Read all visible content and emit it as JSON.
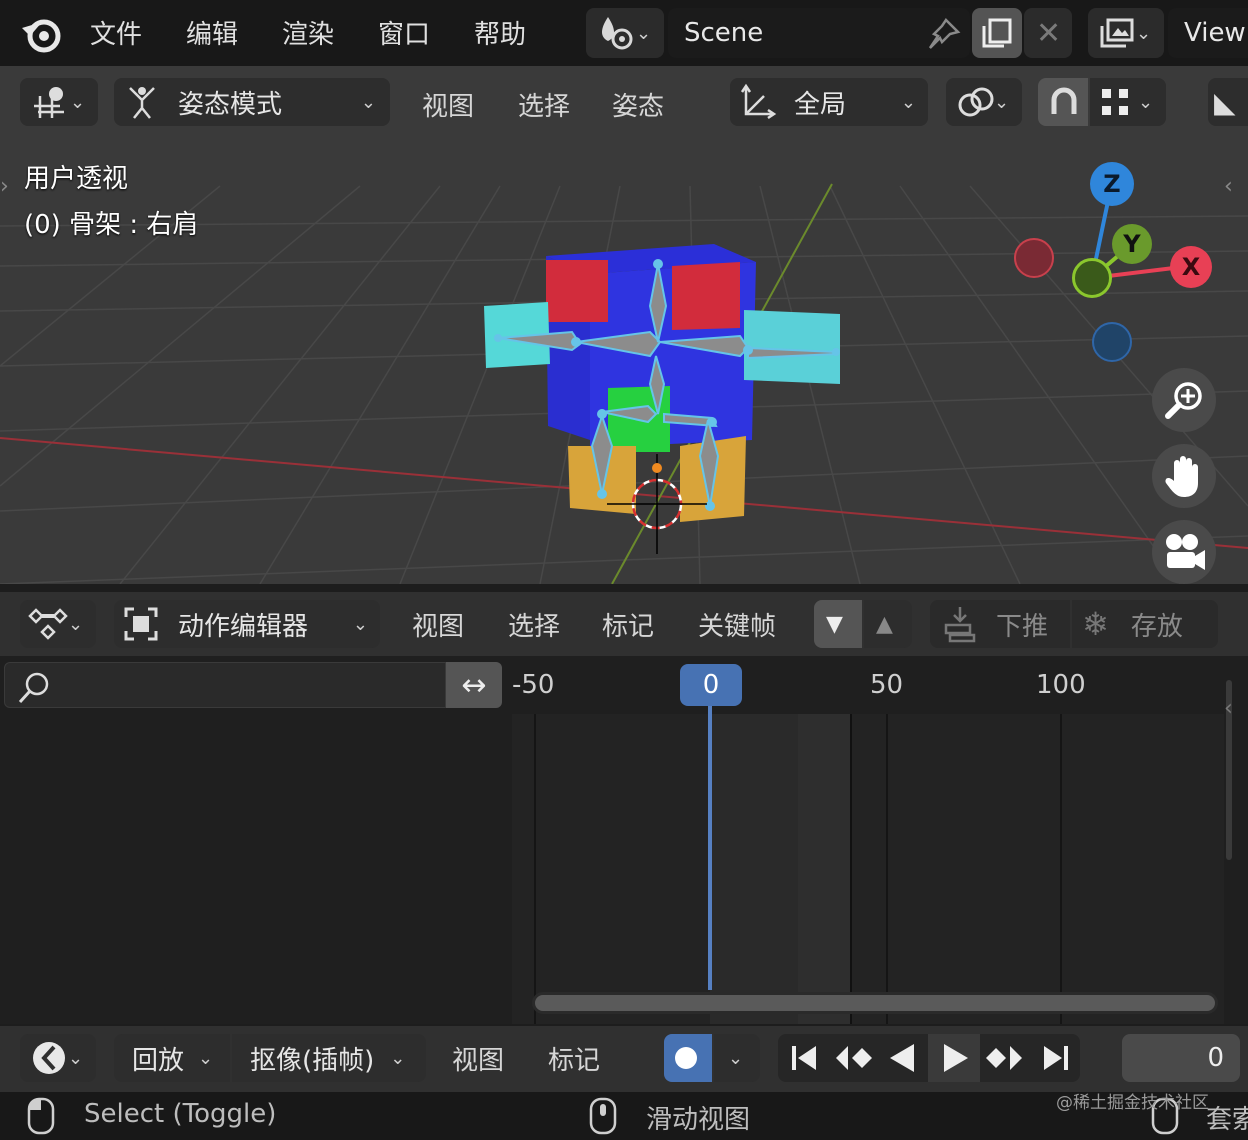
{
  "topbar": {
    "menus": [
      "文件",
      "编辑",
      "渲染",
      "窗口",
      "帮助"
    ],
    "scene_name": "Scene",
    "view_layer": "View"
  },
  "viewport_header": {
    "mode": "姿态模式",
    "menus": [
      "视图",
      "选择",
      "姿态"
    ],
    "transform_orientation": "全局"
  },
  "viewport": {
    "view_name": "用户透视",
    "object_info": "(0) 骨架 : 右肩",
    "gizmo": {
      "z": "Z",
      "y": "Y",
      "x": "X"
    }
  },
  "action_editor": {
    "mode": "动作编辑器",
    "menus": [
      "视图",
      "选择",
      "标记",
      "关键帧"
    ],
    "push_down": "下推",
    "stash": "存放",
    "search_placeholder": "",
    "frame_ticks": [
      "-50",
      "0",
      "50",
      "100"
    ],
    "current_frame_label": "0"
  },
  "timeline": {
    "playback": "回放",
    "keying": "抠像(插帧)",
    "menus": [
      "视图",
      "标记"
    ],
    "current_frame": "0"
  },
  "statusbar": {
    "left": "Select (Toggle)",
    "middle": "滑动视图",
    "right": "套索",
    "watermark": "@稀土掘金技术社区"
  },
  "colors": {
    "accent": "#4772b3",
    "playhead": "#5680c2",
    "axis_x": "#e84055",
    "axis_y": "#8bc72d",
    "axis_z": "#2f86db"
  }
}
